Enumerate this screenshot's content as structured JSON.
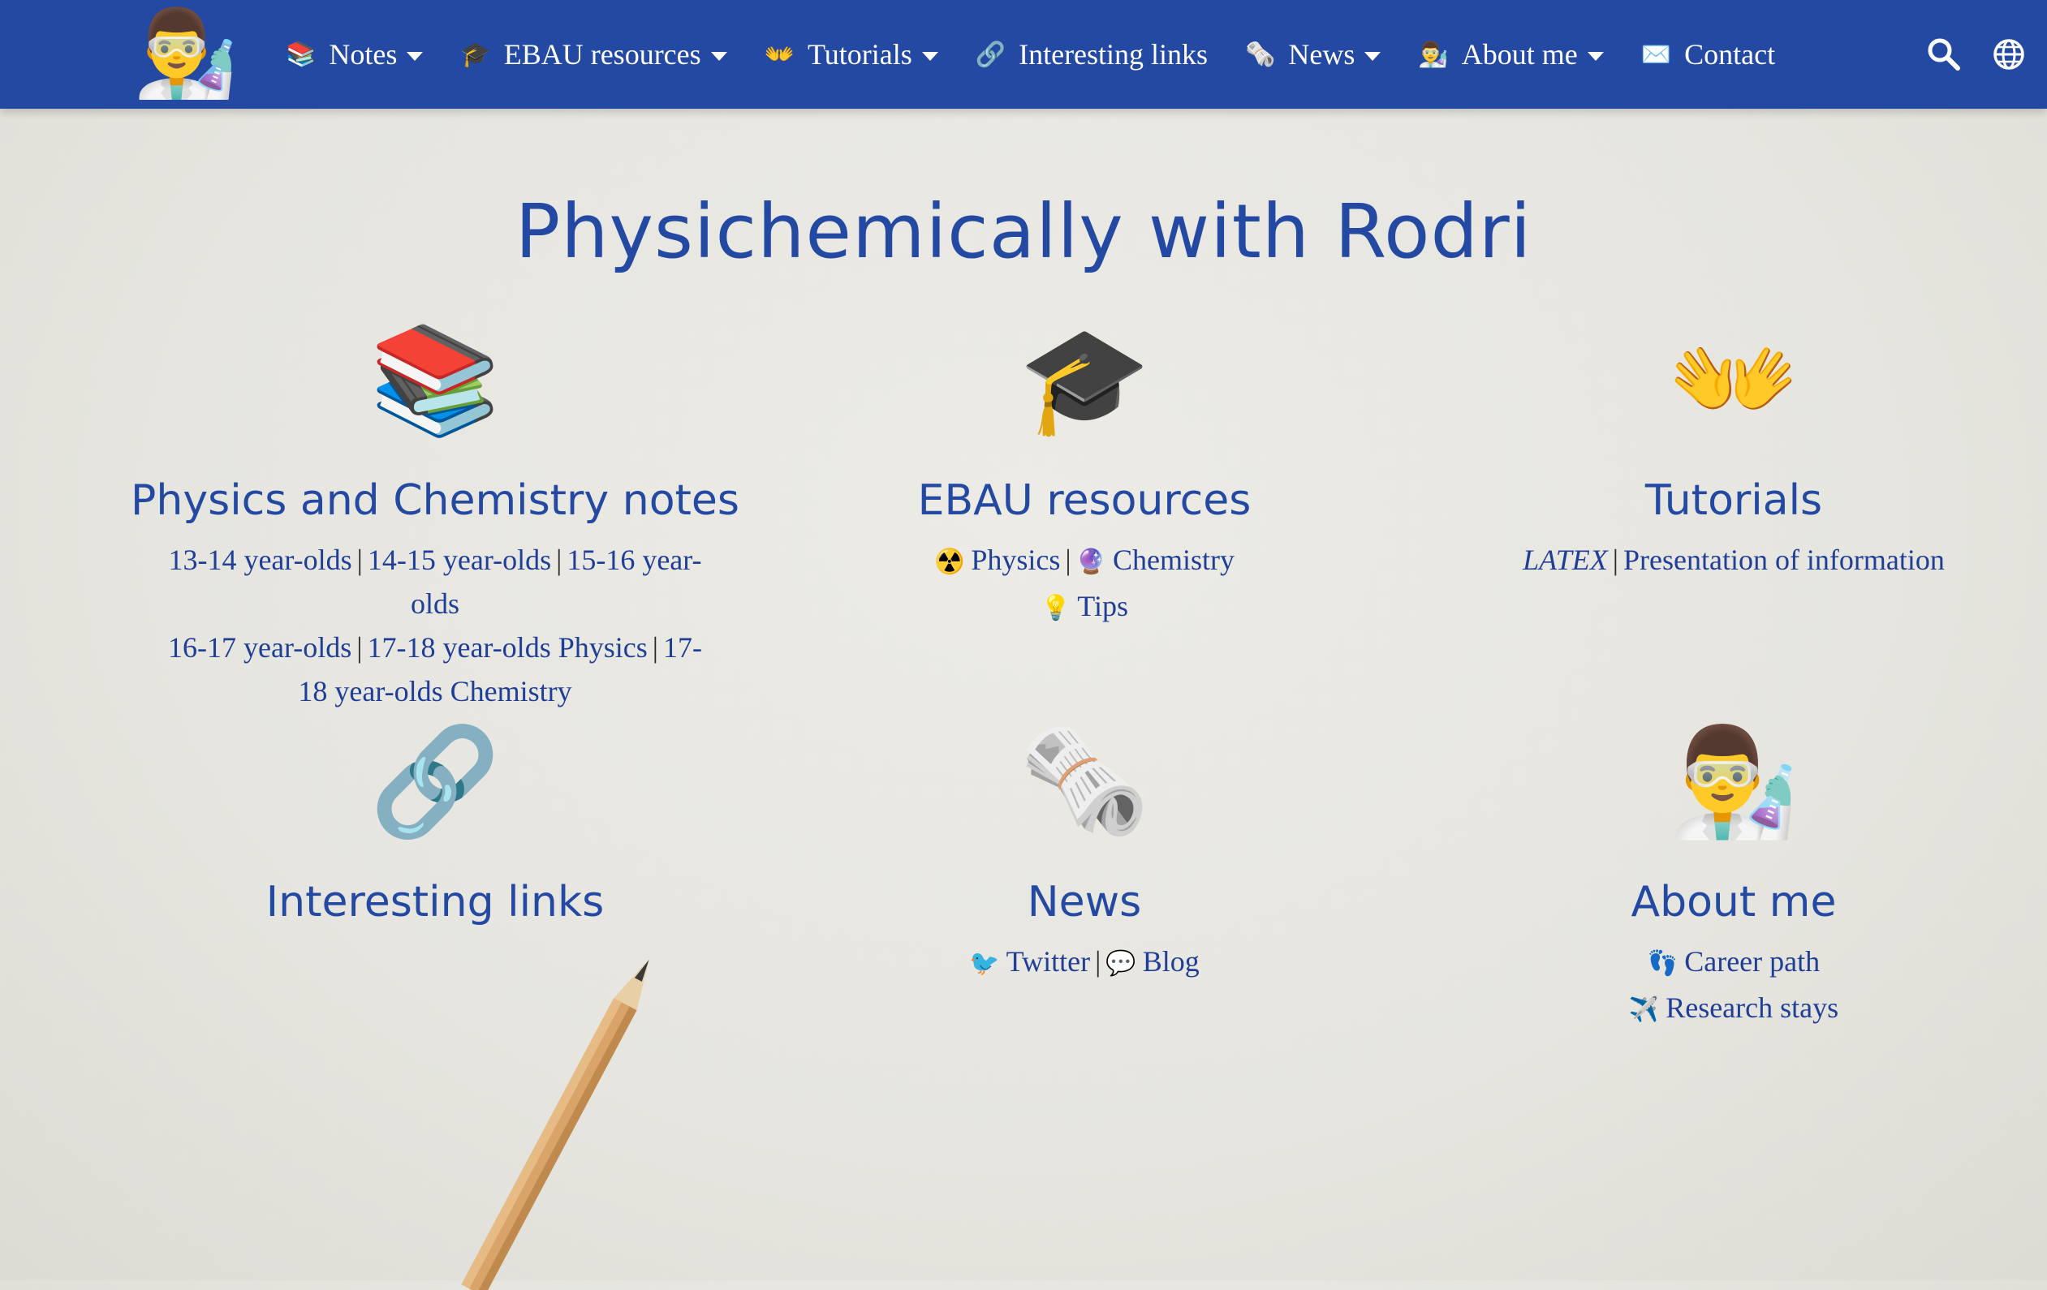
{
  "nav": {
    "logo_icon": "scientist-emoji",
    "items": [
      {
        "icon": "📚",
        "label": "Notes",
        "dropdown": true
      },
      {
        "icon": "🎓",
        "label": "EBAU resources",
        "dropdown": true
      },
      {
        "icon": "👐",
        "label": "Tutorials",
        "dropdown": true
      },
      {
        "icon": "🔗",
        "label": "Interesting links",
        "dropdown": false
      },
      {
        "icon": "🗞️",
        "label": "News",
        "dropdown": true
      },
      {
        "icon": "👨‍🔬",
        "label": "About me",
        "dropdown": true
      },
      {
        "icon": "✉️",
        "label": "Contact",
        "dropdown": false
      }
    ]
  },
  "site_title": "Physichemically with Rodri",
  "cards": {
    "notes": {
      "icon": "📚",
      "title": "Physics and Chemistry notes",
      "links": [
        "13-14 year-olds",
        "14-15 year-olds",
        "15-16 year-olds",
        "16-17 year-olds",
        "17-18 year-olds Physics",
        "17-18 year-olds Chemistry"
      ]
    },
    "ebau": {
      "icon": "🎓",
      "title": "EBAU resources",
      "physics_icon": "☢️",
      "physics": "Physics",
      "chemistry_icon": "🔮",
      "chemistry": "Chemistry",
      "tips_icon": "💡",
      "tips": "Tips"
    },
    "tutorials": {
      "icon": "👐",
      "title": "Tutorials",
      "latex": "LATEX",
      "presentation": "Presentation of information"
    },
    "links": {
      "icon": "🔗",
      "title": "Interesting links"
    },
    "news": {
      "icon": "🗞️",
      "title": "News",
      "twitter_icon": "🐦",
      "twitter": "Twitter",
      "blog_icon": "💬",
      "blog": "Blog"
    },
    "about": {
      "icon": "👨‍🔬",
      "title": "About me",
      "career_icon": "👣",
      "career": "Career path",
      "stays_icon": "✈️",
      "stays": "Research stays"
    }
  },
  "colors": {
    "navbar": "#2449a2",
    "accent": "#2449a2",
    "link": "#1f3f96"
  }
}
